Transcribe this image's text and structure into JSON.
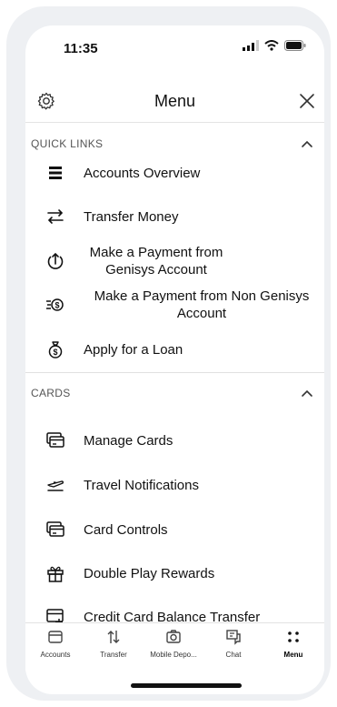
{
  "status_bar": {
    "time": "11:35"
  },
  "header": {
    "title": "Menu"
  },
  "sections": {
    "quick_links": {
      "title": "QUICK LINKS",
      "items": [
        {
          "label": "Accounts Overview",
          "icon": "list-icon"
        },
        {
          "label": "Transfer Money",
          "icon": "transfer-icon"
        },
        {
          "label": "Make a Payment from Genisys Account",
          "icon": "payment-icon"
        },
        {
          "label": "Make a Payment from Non Genisys Account",
          "icon": "payment-dollar-icon"
        },
        {
          "label": "Apply for a Loan",
          "icon": "money-bag-icon"
        }
      ]
    },
    "cards": {
      "title": "CARDS",
      "items": [
        {
          "label": "Manage Cards",
          "icon": "cards-icon"
        },
        {
          "label": "Travel Notifications",
          "icon": "plane-icon"
        },
        {
          "label": "Card Controls",
          "icon": "card-controls-icon"
        },
        {
          "label": "Double Play Rewards",
          "icon": "gift-icon"
        },
        {
          "label": "Credit Card Balance Transfer",
          "icon": "card-transfer-icon"
        }
      ]
    }
  },
  "tabs": [
    {
      "label": "Accounts",
      "icon": "wallet-icon"
    },
    {
      "label": "Transfer",
      "icon": "arrows-updown-icon"
    },
    {
      "label": "Mobile Depo...",
      "icon": "camera-icon"
    },
    {
      "label": "Chat",
      "icon": "chat-icon"
    },
    {
      "label": "Menu",
      "icon": "dots-grid-icon",
      "active": true
    }
  ],
  "colors": {
    "text": "#111111",
    "divider": "#e0e0e0",
    "device": "#eef0f3"
  }
}
